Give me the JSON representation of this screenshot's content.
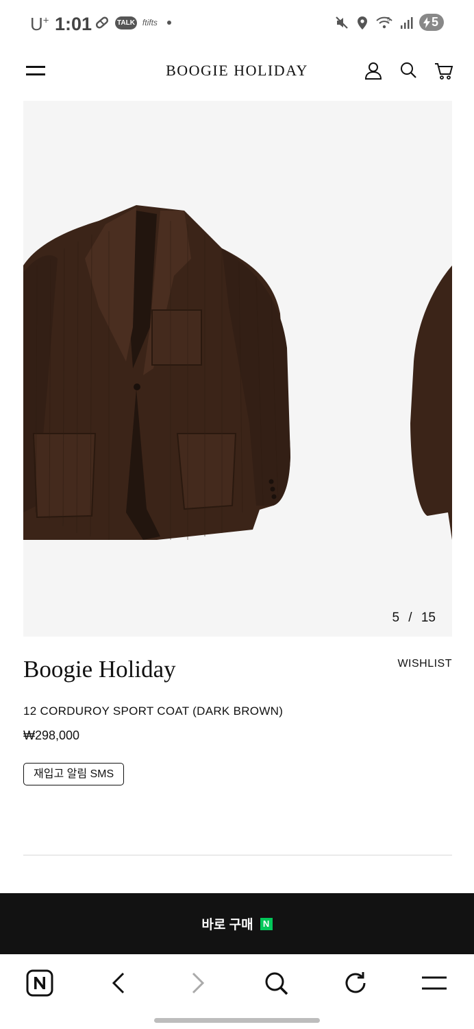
{
  "status_bar": {
    "carrier": "U",
    "carrier_sup": "+",
    "time": "1:01",
    "talk_badge": "TALK",
    "app_text": "ftifts",
    "battery_level": "5",
    "network": "5"
  },
  "header": {
    "brand": "BOOGIE HOLIDAY"
  },
  "gallery": {
    "current": "5",
    "separator": "/",
    "total": "15"
  },
  "product": {
    "brand": "Boogie Holiday",
    "wishlist_label": "WISHLIST",
    "name": "12 CORDUROY SPORT COAT (DARK BROWN)",
    "price": "₩298,000",
    "restock_label": "재입고 알림 SMS"
  },
  "buy_bar": {
    "label": "바로 구매",
    "npay_badge": "N",
    "npay_color": "#03c75a"
  },
  "colors": {
    "jacket": "#3b2418",
    "bar_bg": "#121212"
  },
  "browser_nav": {
    "icons": [
      "naver-home-icon",
      "back-icon",
      "forward-icon",
      "search-icon",
      "reload-icon",
      "menu-icon"
    ]
  }
}
